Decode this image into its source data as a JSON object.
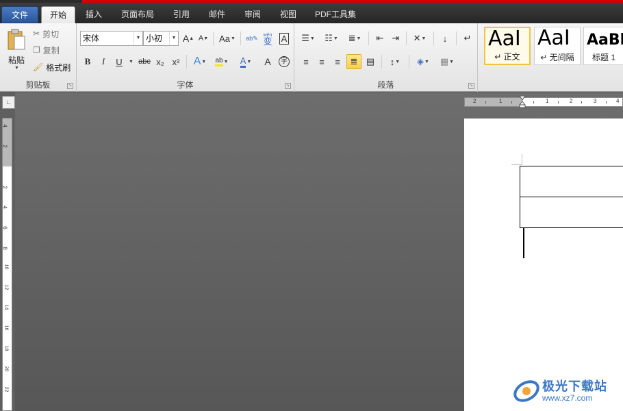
{
  "tabs": [
    "文件",
    "开始",
    "插入",
    "页面布局",
    "引用",
    "邮件",
    "审阅",
    "视图",
    "PDF工具集"
  ],
  "clipboard": {
    "paste": "粘贴",
    "cut": "剪切",
    "copy": "复制",
    "format_painter": "格式刷",
    "group_label": "剪贴板"
  },
  "font": {
    "name": "宋体",
    "size": "小初",
    "group_label": "字体",
    "labels": {
      "aa": "Aa",
      "b": "B",
      "i": "I",
      "u": "U",
      "strike": "abc",
      "sub": "x₂",
      "sup": "x²",
      "bigA": "A",
      "smallA": "A",
      "fx": "A",
      "highlight": "ab",
      "color": "A",
      "char": "A",
      "circle": "字",
      "pinyin": "wén",
      "border": "A"
    }
  },
  "paragraph": {
    "group_label": "段落"
  },
  "styles": [
    {
      "preview": "AaI",
      "name": "↵ 正文"
    },
    {
      "preview": "AaI",
      "name": "↵ 无间隔"
    },
    {
      "preview": "AaBl",
      "name": "标题 1"
    }
  ],
  "ruler_h": [
    "2",
    "1",
    "1",
    "1",
    "2",
    "3",
    "4"
  ],
  "ruler_v": [
    "4",
    "2",
    "2",
    "4",
    "6",
    "8",
    "10",
    "12",
    "14",
    "16",
    "18",
    "20",
    "22"
  ],
  "watermark": {
    "title": "极光下载站",
    "url": "www.xz7.com"
  },
  "colors": {
    "file_tab": "#2a5699",
    "accent_red": "#d40000",
    "selected_style": "#f0c246"
  }
}
